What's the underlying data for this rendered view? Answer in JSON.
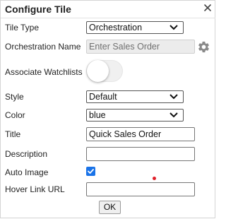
{
  "dialog": {
    "title": "Configure Tile",
    "close_icon": "close-icon"
  },
  "form": {
    "tile_type": {
      "label": "Tile Type",
      "value": "Orchestration"
    },
    "orchestration_name": {
      "label": "Orchestration Name",
      "placeholder": "Enter Sales Order",
      "settings_icon": "gear-icon"
    },
    "associate_watchlists": {
      "label": "Associate Watchlists",
      "on": false
    },
    "style": {
      "label": "Style",
      "value": "Default"
    },
    "color": {
      "label": "Color",
      "value": "blue"
    },
    "title": {
      "label": "Title",
      "value": "Quick Sales Order"
    },
    "description": {
      "label": "Description",
      "value": ""
    },
    "auto_image": {
      "label": "Auto Image",
      "checked": true
    },
    "hover_link_url": {
      "label": "Hover Link URL",
      "value": ""
    }
  },
  "actions": {
    "ok_label": "OK"
  },
  "colors": {
    "checkbox": "#1a73e8",
    "gear": "#8a8a8a",
    "marker_dot": "#e0202a"
  }
}
